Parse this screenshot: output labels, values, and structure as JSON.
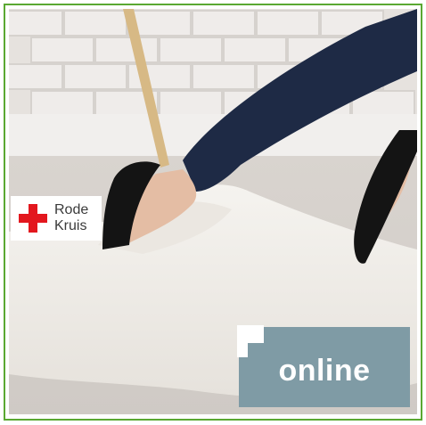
{
  "logo": {
    "line1": "Rode",
    "line2": "Kruis",
    "icon": "red-cross-icon",
    "cross_color": "#e3171e"
  },
  "badge": {
    "label": "online",
    "color": "#7f9ba5"
  },
  "frame_color": "#5aa832"
}
